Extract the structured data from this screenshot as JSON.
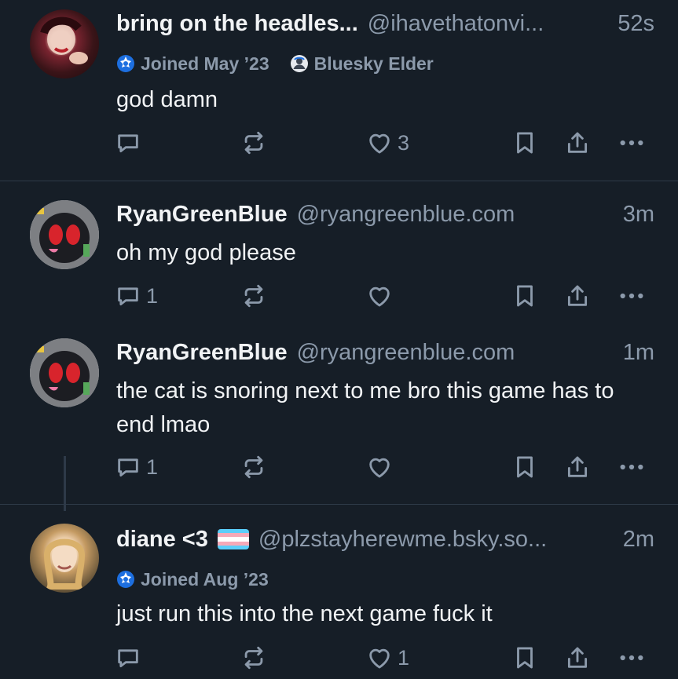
{
  "posts": [
    {
      "display_name": "bring on the headles...",
      "handle": "@ihavethatonvi...",
      "time": "52s",
      "badges": [
        "Joined May ’23",
        "Bluesky Elder"
      ],
      "text": "god damn",
      "replies": "",
      "likes": "3"
    },
    {
      "display_name": "RyanGreenBlue",
      "handle": "@ryangreenblue.com",
      "time": "3m",
      "text": "oh my god please",
      "replies": "1",
      "likes": ""
    },
    {
      "display_name": "RyanGreenBlue",
      "handle": "@ryangreenblue.com",
      "time": "1m",
      "text": "the cat is snoring next to me bro this game has to end lmao",
      "replies": "1",
      "likes": ""
    },
    {
      "display_name": "diane <3",
      "handle": "@plzstayherewme.bsky.so...",
      "time": "2m",
      "badges": [
        "Joined Aug ’23"
      ],
      "text": "just run this into the next game fuck it",
      "replies": "",
      "likes": "1"
    }
  ],
  "colors": {
    "background": "#161e27",
    "muted": "#8c9aab",
    "text": "#f1f3f5",
    "badge_blue": "#1d6fe0"
  },
  "icons": [
    "reply-icon",
    "repost-icon",
    "like-icon",
    "bookmark-icon",
    "share-icon",
    "more-icon",
    "new-account-icon",
    "elder-badge-icon",
    "trans-flag-icon"
  ]
}
